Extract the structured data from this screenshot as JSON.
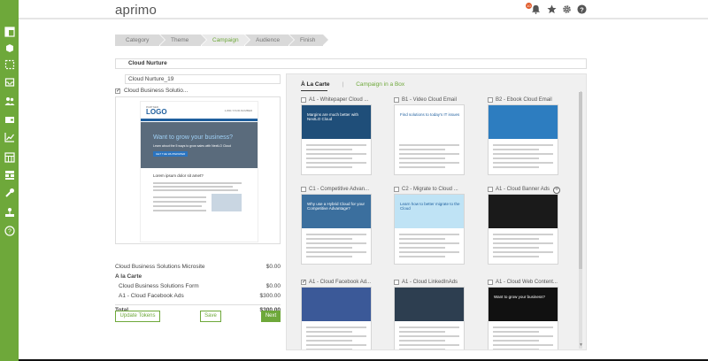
{
  "brand": {
    "logo_text": "aprimo",
    "accent": "#6ea83a",
    "badge_color": "#e05c2c"
  },
  "header": {
    "notification_count": "10",
    "icons": [
      "bell-icon",
      "star-icon",
      "gear-icon",
      "help-icon"
    ]
  },
  "sidebar": {
    "icons": [
      "dashboard-icon",
      "products-icon",
      "selection-icon",
      "inbox-icon",
      "users-icon",
      "wallet-icon",
      "calendar-icon",
      "chart-icon",
      "layout-icon",
      "sitemap-icon",
      "tools-icon",
      "org-icon",
      "help-icon"
    ]
  },
  "wizard": {
    "steps": [
      {
        "label": "Category"
      },
      {
        "label": "Theme"
      },
      {
        "label": "Campaign"
      },
      {
        "label": "Audience"
      },
      {
        "label": "Finish"
      }
    ],
    "active_index": 2
  },
  "campaign": {
    "title": "Cloud Nurture",
    "name_value": "Cloud Nurture_19",
    "include_label": "Cloud Business Solutio..."
  },
  "preview": {
    "logo_sub": "PARTNER",
    "logo": "LOGO",
    "contact": "1-800-YOUR-NUMBER",
    "hero_title": "Want to grow your business?",
    "hero_text": "Learn about the 5 ways to grow sales with NextLO Cloud",
    "hero_button": "GET THE WHITEPAPER",
    "lorem": "Lorem ipsum dolor sit amet?"
  },
  "summary": {
    "rows": [
      {
        "label": "Cloud Business Solutions Microsite",
        "value": "$0.00",
        "style": "normal"
      },
      {
        "label": "A la Carte",
        "value": "",
        "style": "heading"
      },
      {
        "label": "Cloud Business Solutions Form",
        "value": "$0.00",
        "style": "indent"
      },
      {
        "label": "A1 - Cloud Facebook Ads",
        "value": "$300.00",
        "style": "indent"
      }
    ],
    "total_label": "Total",
    "total_value": "$300.00"
  },
  "buttons": {
    "update": "Update Tokens",
    "save": "Save",
    "next": "Next"
  },
  "tabs": {
    "carte": "À La Carte",
    "box": "Campaign in a Box"
  },
  "cards": [
    {
      "label": "A1 - Whitepaper Cloud ...",
      "checked": false,
      "hero": "#1f4e79",
      "hero_text": "Margins are much better with NextLO Cloud"
    },
    {
      "label": "B1 - Video Cloud Email",
      "checked": false,
      "hero": "#ffffff",
      "hero_text": "Find solutions to today's IT issues"
    },
    {
      "label": "B2 - Ebook Cloud Email",
      "checked": false,
      "hero": "#2d7dc0",
      "hero_text": ""
    },
    {
      "label": "C1 - Competitive Advan...",
      "checked": false,
      "hero": "#3b6f9e",
      "hero_text": "Why use a Hybrid Cloud for your Competitive Advantage?"
    },
    {
      "label": "C2 - Migrate to Cloud ...",
      "checked": false,
      "hero": "#bfe3f5",
      "hero_text": "Learn how to better migrate to the Cloud"
    },
    {
      "label": "A1 - Cloud Banner Ads",
      "checked": false,
      "hero": "#1a1a1a",
      "hero_text": ""
    },
    {
      "label": "A1 - Cloud Facebook Ad...",
      "checked": true,
      "hero": "#3b5998",
      "hero_text": ""
    },
    {
      "label": "A1 - Cloud LinkedInAds",
      "checked": false,
      "hero": "#2d3e50",
      "hero_text": ""
    },
    {
      "label": "A1 - Cloud Web Content...",
      "checked": false,
      "hero": "#111111",
      "hero_text": "Want to grow your business?"
    }
  ]
}
